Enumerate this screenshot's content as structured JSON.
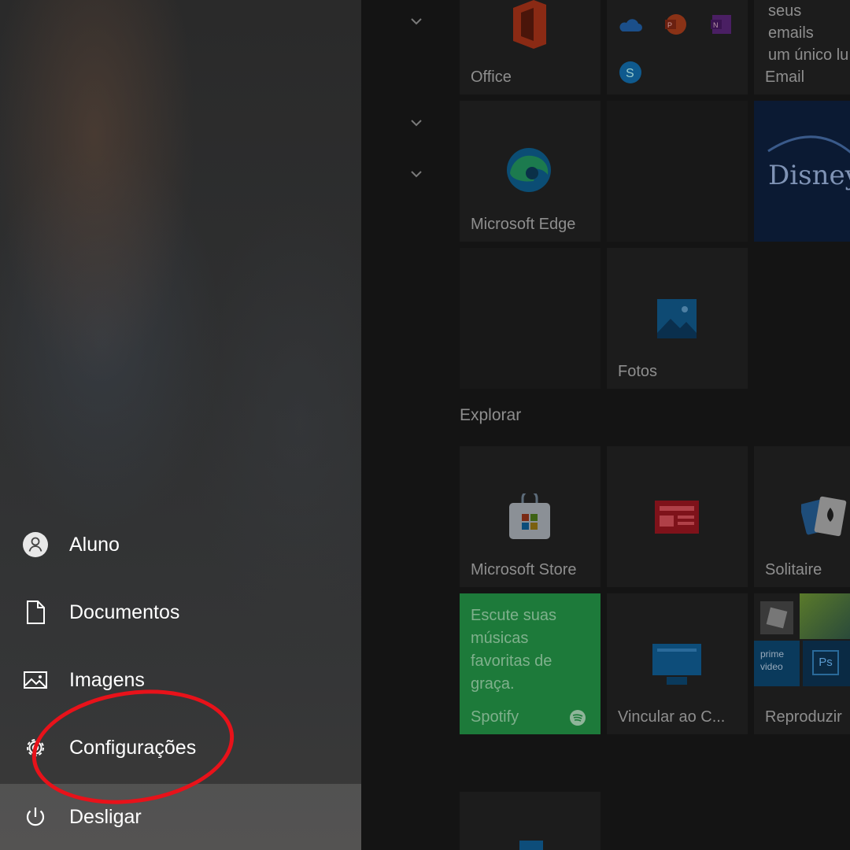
{
  "nav": {
    "items": [
      {
        "label": "Aluno",
        "icon": "user-avatar-icon"
      },
      {
        "label": "Documentos",
        "icon": "document-icon"
      },
      {
        "label": "Imagens",
        "icon": "image-icon"
      },
      {
        "label": "Configurações",
        "icon": "gear-icon"
      },
      {
        "label": "Desligar",
        "icon": "power-icon"
      }
    ]
  },
  "tiles": {
    "office": {
      "label": "Office"
    },
    "email": {
      "label": "Email",
      "text_line1": "seus emails",
      "text_line2": "um único lu"
    },
    "edge": {
      "label": "Microsoft Edge"
    },
    "disney": {
      "label": "Disney"
    },
    "fotos": {
      "label": "Fotos"
    },
    "store": {
      "label": "Microsoft Store"
    },
    "solitaire": {
      "label": "Solitaire"
    },
    "spotify": {
      "label": "Spotify",
      "text": "Escute suas músicas favoritas de graça."
    },
    "vincular": {
      "label": "Vincular ao C..."
    },
    "reproduzir": {
      "label": "Reproduzir",
      "prime_line1": "prime",
      "prime_line2": "video",
      "ps": "Ps"
    }
  },
  "sections": {
    "explorar": "Explorar"
  },
  "colors": {
    "highlight_ellipse": "#e8121a",
    "spotify_tile": "#1d7a3a",
    "dimmed_text": "#8e8e8e"
  }
}
